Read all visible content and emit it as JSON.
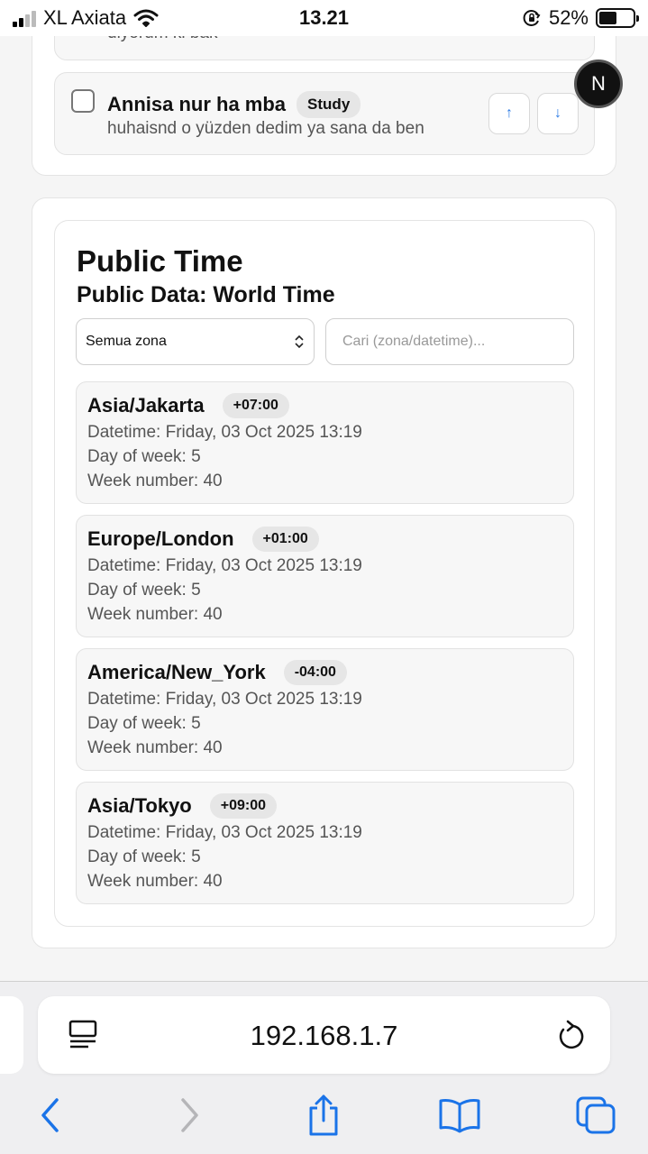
{
  "status_bar": {
    "carrier": "XL Axiata",
    "time": "13.21",
    "battery_percent": "52%",
    "battery_level": 0.52
  },
  "todo": {
    "prev_item_desc": "diyorum ki bak",
    "item": {
      "title": "Annisa nur ha mba",
      "tag": "Study",
      "description": "huhaisnd o yüzden dedim ya sana da ben",
      "checked": false
    },
    "up_arrow": "↑",
    "down_arrow": "↓"
  },
  "fab": {
    "label": "N"
  },
  "public_time": {
    "title": "Public Time",
    "subtitle": "Public Data: World Time",
    "filter_selected": "Semua zona",
    "search_placeholder": "Cari (zona/datetime)...",
    "zones": [
      {
        "name": "Asia/Jakarta",
        "offset": "+07:00",
        "datetime": "Datetime: Friday, 03 Oct 2025 13:19",
        "day_of_week": "Day of week: 5",
        "week_number": "Week number: 40"
      },
      {
        "name": "Europe/London",
        "offset": "+01:00",
        "datetime": "Datetime: Friday, 03 Oct 2025 13:19",
        "day_of_week": "Day of week: 5",
        "week_number": "Week number: 40"
      },
      {
        "name": "America/New_York",
        "offset": "-04:00",
        "datetime": "Datetime: Friday, 03 Oct 2025 13:19",
        "day_of_week": "Day of week: 5",
        "week_number": "Week number: 40"
      },
      {
        "name": "Asia/Tokyo",
        "offset": "+09:00",
        "datetime": "Datetime: Friday, 03 Oct 2025 13:19",
        "day_of_week": "Day of week: 5",
        "week_number": "Week number: 40"
      }
    ]
  },
  "browser": {
    "url": "192.168.1.7",
    "accent_color": "#2c7be5"
  }
}
